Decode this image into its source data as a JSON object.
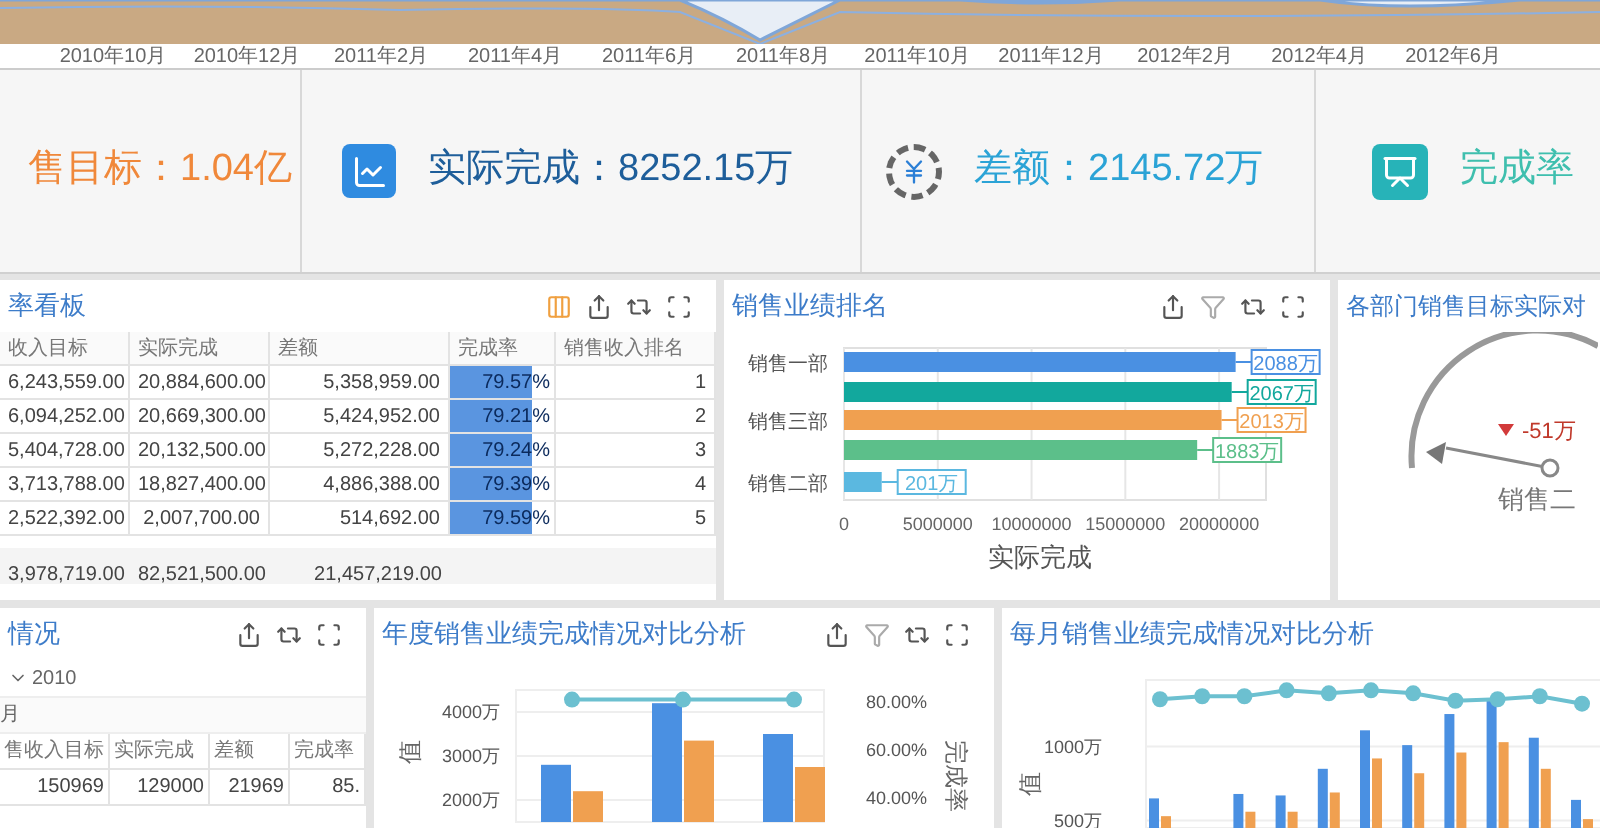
{
  "timeline": {
    "labels": [
      "2010年10月",
      "2010年12月",
      "2011年2月",
      "2011年4月",
      "2011年6月",
      "2011年8月",
      "2011年10月",
      "2011年12月",
      "2012年2月",
      "2012年4月",
      "2012年6月"
    ]
  },
  "kpis": [
    {
      "kind": "target",
      "text": "售目标：1.04亿"
    },
    {
      "kind": "actual",
      "text": "实际完成：8252.15万"
    },
    {
      "kind": "gap",
      "text": "差额：2145.72万"
    },
    {
      "kind": "rate",
      "text": "完成率"
    }
  ],
  "rate_board": {
    "title": "率看板",
    "columns": [
      "收入目标",
      "实际完成",
      "差额",
      "完成率",
      "销售收入排名"
    ],
    "rows": [
      {
        "cells": [
          "6,243,559.00",
          "20,884,600.00",
          "5,358,959.00"
        ],
        "rate": "79.57%",
        "level": 0.7957,
        "rank": "1"
      },
      {
        "cells": [
          "6,094,252.00",
          "20,669,300.00",
          "5,424,952.00"
        ],
        "rate": "79.21%",
        "level": 0.7921,
        "rank": "2"
      },
      {
        "cells": [
          "5,404,728.00",
          "20,132,500.00",
          "5,272,228.00"
        ],
        "rate": "79.24%",
        "level": 0.7924,
        "rank": "3"
      },
      {
        "cells": [
          "3,713,788.00",
          "18,827,400.00",
          "4,886,388.00"
        ],
        "rate": "79.39%",
        "level": 0.7939,
        "rank": "4"
      },
      {
        "cells": [
          "2,522,392.00",
          "2,007,700.00",
          "514,692.00"
        ],
        "rate": "79.59%",
        "level": 0.7959,
        "rank": "5"
      }
    ],
    "total": [
      "3,978,719.00",
      "82,521,500.00",
      "21,457,219.00"
    ]
  },
  "ranking": {
    "title": "销售业绩排名",
    "chart_data": {
      "type": "bar",
      "orientation": "horizontal",
      "grid": true,
      "categories": [
        "销售一部",
        null,
        "销售三部",
        null,
        "销售二部"
      ],
      "xlabel": "实际完成",
      "xlim": [
        0,
        22500000
      ],
      "xticks": [
        0,
        5000000,
        10000000,
        15000000,
        20000000
      ],
      "series": [
        {
          "values": [
            20880000,
            20670000,
            20130000,
            18830000,
            2010000
          ]
        }
      ],
      "colors": [
        "#4a90e2",
        "#12a89d",
        "#f0a050",
        "#5cbf8a",
        "#5bb8e0"
      ],
      "value_labels": [
        "2088万",
        "2067万",
        "2013万",
        "1883万",
        "201万"
      ]
    }
  },
  "gauge": {
    "title": "各部门销售目标实际对",
    "delta": "-51万",
    "label": "销售二"
  },
  "month_table": {
    "title": "情况",
    "tree": {
      "label": "2010",
      "expanded": true,
      "children": [
        {
          "label": "月"
        }
      ]
    },
    "columns": [
      "售收入目标",
      "实际完成",
      "差额",
      "完成率"
    ],
    "rows": [
      [
        "150969",
        "129000",
        "21969",
        "85."
      ]
    ]
  },
  "annual": {
    "title": "年度销售业绩完成情况对比分析",
    "chart_data": {
      "type": "bar",
      "stacked": false,
      "grid": true,
      "ylabel": "值",
      "ylim": [
        1500,
        4500
      ],
      "yticks": [
        {
          "value": 2000,
          "label": "2000万"
        },
        {
          "value": 3000,
          "label": "3000万"
        },
        {
          "value": 4000,
          "label": "4000万"
        }
      ],
      "y2label": "完成率",
      "y2lim": [
        30,
        85
      ],
      "y2ticks": [
        {
          "value": 40,
          "label": "40.00%"
        },
        {
          "value": 60,
          "label": "60.00%"
        },
        {
          "value": 80,
          "label": "80.00%"
        }
      ],
      "series": [
        {
          "color": "#4a90e2",
          "values": [
            2800,
            4200,
            3500
          ]
        },
        {
          "color": "#f0a050",
          "values": [
            2200,
            3350,
            2750
          ]
        },
        {
          "color": "#6cc0d0",
          "type": "line",
          "axis": "y2",
          "marker": true,
          "values": [
            81,
            81,
            81
          ]
        }
      ]
    }
  },
  "monthly": {
    "title": "每月销售业绩完成情况对比分析",
    "chart_data": {
      "type": "bar",
      "stacked": false,
      "grid": true,
      "ylabel": "值",
      "ylim": [
        450,
        1450
      ],
      "yticks": [
        {
          "value": 500,
          "label": "500万"
        },
        {
          "value": 1000,
          "label": "1000万"
        }
      ],
      "series": [
        {
          "color": "#4a90e2",
          "values": [
            650,
            null,
            680,
            670,
            850,
            1110,
            1010,
            1220,
            1310,
            1060,
            640
          ]
        },
        {
          "color": "#f0a050",
          "values": [
            530,
            null,
            560,
            560,
            690,
            920,
            820,
            960,
            1030,
            850,
            510
          ]
        },
        {
          "color": "#6cc0d0",
          "type": "line",
          "marker": true,
          "values": [
            1320,
            1340,
            1340,
            1380,
            1360,
            1380,
            1360,
            1310,
            1320,
            1340,
            1290
          ]
        }
      ]
    }
  }
}
